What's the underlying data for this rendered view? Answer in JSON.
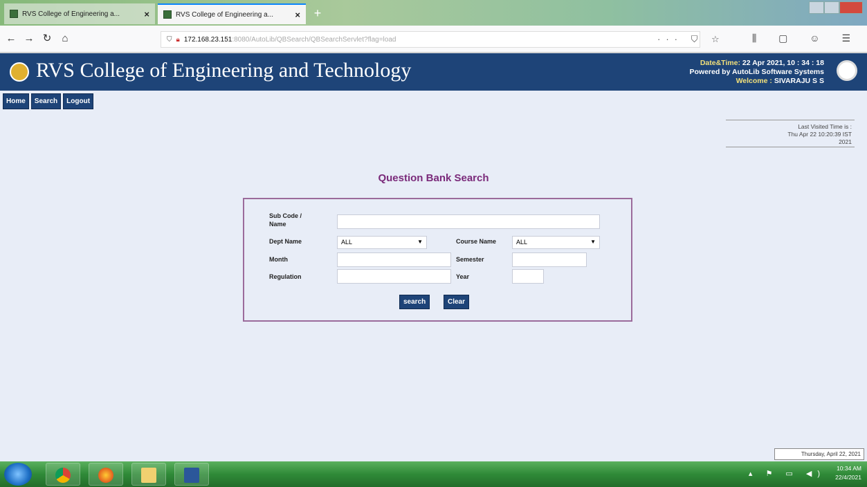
{
  "browser": {
    "tabs": [
      {
        "title": "RVS College of Engineering a...",
        "active": false
      },
      {
        "title": "RVS College of Engineering a...",
        "active": true
      }
    ],
    "new_tab_label": "+",
    "url": {
      "host": "172.168.23.151",
      "path": ":8080/AutoLib/QBSearch/QBSearchServlet?flag=load"
    },
    "nav_icons": [
      "back-icon",
      "forward-icon",
      "reload-icon",
      "home-icon"
    ],
    "url_icons": "··· ⛉ ☆",
    "right_icons": "⫼ ▢ ☺ ☰"
  },
  "banner": {
    "college_name": "RVS College of Engineering and Technology",
    "date_label": "Date&Time:",
    "date_value": "22 Apr 2021, 10 : 34 : 18",
    "powered": "Powered by AutoLib Software Systems",
    "welcome_label": "Welcome :",
    "welcome_user": "SIVARAJU S S"
  },
  "menu": {
    "home": "Home",
    "search": "Search",
    "logout": "Logout"
  },
  "last_visit": {
    "line1": "Last Visited Time is :",
    "line2": "Thu Apr 22 10:20:39 IST",
    "line3": "2021"
  },
  "form": {
    "heading": "Question Bank Search",
    "sub_code_label": "Sub Code / Name",
    "sub_code_value": "",
    "dept_label": "Dept Name",
    "dept_value": "ALL",
    "course_label": "Course Name",
    "course_value": "ALL",
    "month_label": "Month",
    "month_value": "",
    "semester_label": "Semester",
    "semester_value": "",
    "regulation_label": "Regulation",
    "regulation_value": "",
    "year_label": "Year",
    "year_value": "",
    "search_btn": "search",
    "clear_btn": "Clear"
  },
  "date_tooltip": "Thursday, April 22, 2021",
  "taskbar": {
    "apps": [
      "start-button",
      "chrome-app",
      "firefox-app",
      "explorer-app",
      "word-app"
    ],
    "tray_icons": "▴ ⚑ ▭ ◀)",
    "time": "10:34 AM",
    "date": "22/4/2021"
  },
  "colors": {
    "banner": "#1e4478",
    "heading": "#7a2a7a",
    "taskbar": "#2f8a38"
  }
}
